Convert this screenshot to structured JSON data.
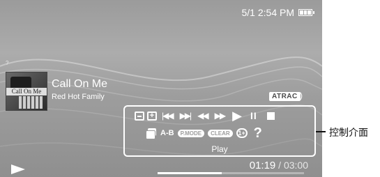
{
  "status_bar": {
    "date_time": "5/1 2:54 PM",
    "battery_level": 1.0
  },
  "track": {
    "album_art_text": "Call On Me",
    "title": "Call On Me",
    "artist": "Red Hot Family",
    "codec_badge": "ATRAC"
  },
  "control_panel": {
    "row1": [
      {
        "name": "display-mode-icon"
      },
      {
        "name": "add-icon",
        "symbol": "+"
      },
      {
        "name": "previous-track-icon",
        "symbol": "|◀◀"
      },
      {
        "name": "next-track-icon",
        "symbol": "▶▶|"
      },
      {
        "name": "rewind-icon",
        "symbol": "◀◀"
      },
      {
        "name": "fast-forward-icon",
        "symbol": "▶▶"
      },
      {
        "name": "play-icon",
        "symbol": "▶"
      },
      {
        "name": "pause-icon",
        "symbol": "II"
      },
      {
        "name": "stop-icon"
      }
    ],
    "ab_label": "A-B",
    "pmode_label": "P.MODE",
    "clear_label": "CLEAR",
    "repeat_symbol": "1+",
    "help_symbol": "?",
    "status_text": "Play"
  },
  "playback": {
    "current_time": "01:19",
    "separator": "/",
    "total_time": "03:00",
    "progress": 0.44
  },
  "callout": {
    "label": "控制介面"
  },
  "colors": {
    "ui_text": "#ffffff",
    "background": "#a0a0a0",
    "callout_text": "#111111"
  }
}
